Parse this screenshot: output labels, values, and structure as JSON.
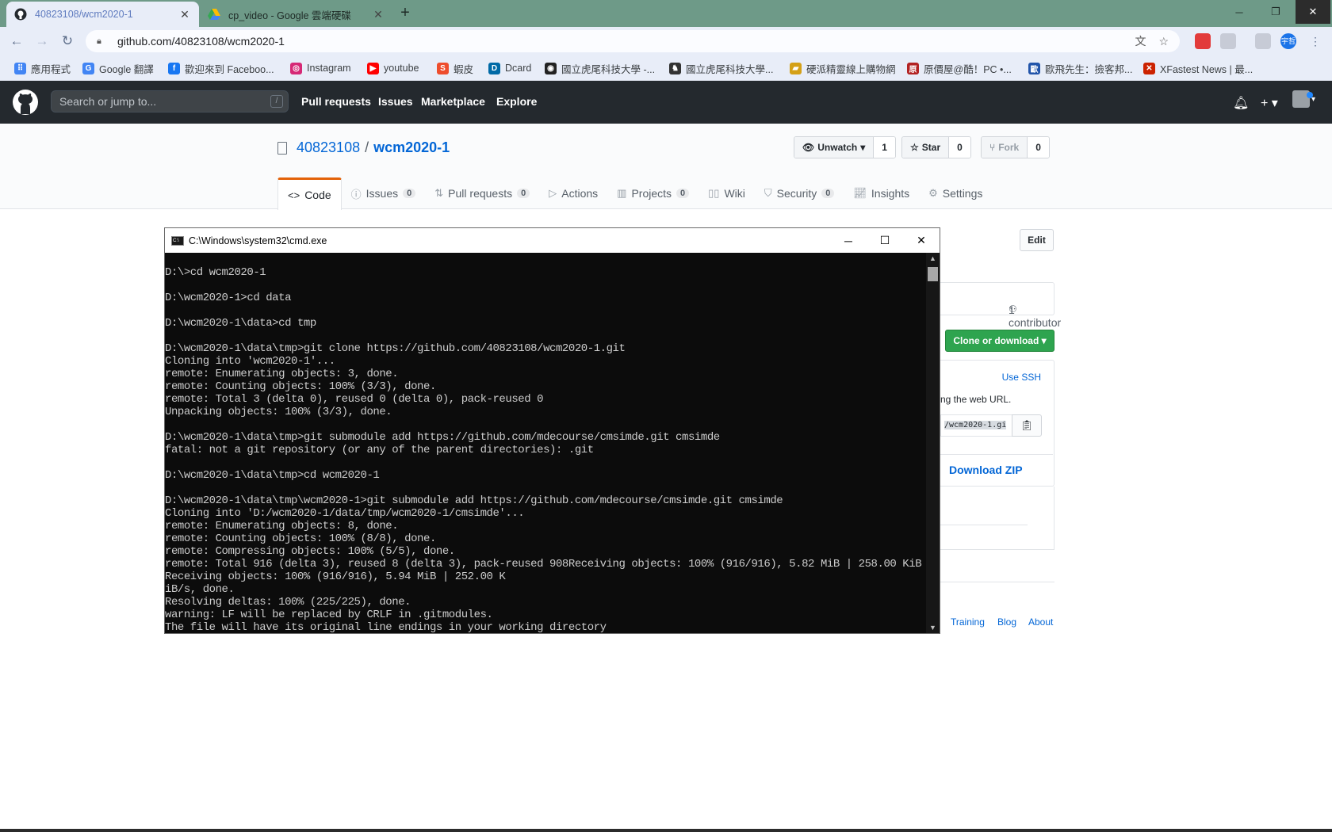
{
  "browser": {
    "tabs": [
      {
        "title": "40823108/wcm2020-1",
        "active": true
      },
      {
        "title": "cp_video - Google 雲端硬碟",
        "active": false
      }
    ],
    "url": "github.com/40823108/wcm2020-1",
    "profile_label": "宇哲",
    "bookmarks": [
      {
        "label": "應用程式",
        "color": "#4285f4"
      },
      {
        "label": "Google 翻譯",
        "color": "#4285f4"
      },
      {
        "label": "歡迎來到 Faceboo...",
        "color": "#1877f2"
      },
      {
        "label": "Instagram",
        "color": "#d62976"
      },
      {
        "label": "youtube",
        "color": "#ff0000"
      },
      {
        "label": "蝦皮",
        "color": "#ee4d2d"
      },
      {
        "label": "Dcard",
        "color": "#006aa6"
      },
      {
        "label": "國立虎尾科技大學 -...",
        "color": "#222222"
      },
      {
        "label": "國立虎尾科技大學...",
        "color": "#333333"
      },
      {
        "label": "硬派精靈線上購物網",
        "color": "#d4a017"
      },
      {
        "label": "原價屋@酷！PC •...",
        "color": "#b22222"
      },
      {
        "label": "歐飛先生：撿客邦...",
        "color": "#2255aa"
      },
      {
        "label": "XFastest News | 最...",
        "color": "#cc2200"
      }
    ]
  },
  "github": {
    "search_placeholder": "Search or jump to...",
    "search_key": "/",
    "nav": [
      "Pull requests",
      "Issues",
      "Marketplace",
      "Explore"
    ],
    "repo": {
      "owner": "40823108",
      "separator": "/",
      "name": "wcm2020-1"
    },
    "actions": [
      {
        "label": "Unwatch",
        "count": "1"
      },
      {
        "label": "Star",
        "count": "0"
      },
      {
        "label": "Fork",
        "count": "0"
      }
    ],
    "tabs": [
      {
        "label": "Code",
        "icon": "code-icon",
        "count": ""
      },
      {
        "label": "Issues",
        "icon": "issue-icon",
        "count": "0"
      },
      {
        "label": "Pull requests",
        "icon": "pull-request-icon",
        "count": "0"
      },
      {
        "label": "Actions",
        "icon": "play-icon",
        "count": ""
      },
      {
        "label": "Projects",
        "icon": "project-icon",
        "count": "0"
      },
      {
        "label": "Wiki",
        "icon": "book-icon",
        "count": ""
      },
      {
        "label": "Security",
        "icon": "shield-icon",
        "count": "0"
      },
      {
        "label": "Insights",
        "icon": "graph-icon",
        "count": ""
      },
      {
        "label": "Settings",
        "icon": "gear-icon",
        "count": ""
      }
    ],
    "edit_label": "Edit",
    "contributors": "1 contributor",
    "clone_label": "Clone or download ▾",
    "use_ssh": "Use SSH",
    "clone_hint": "ng the web URL.",
    "clone_url_fragment": "/wcm2020-1.gi",
    "download_zip": "Download ZIP",
    "footer_links": [
      "Training",
      "Blog",
      "About"
    ],
    "accent": "#0366d6",
    "green": "#2ea44f"
  },
  "cmd": {
    "title": "C:\\Windows\\system32\\cmd.exe",
    "output": "D:\\>cd wcm2020-1\n\nD:\\wcm2020-1>cd data\n\nD:\\wcm2020-1\\data>cd tmp\n\nD:\\wcm2020-1\\data\\tmp>git clone https://github.com/40823108/wcm2020-1.git\nCloning into 'wcm2020-1'...\nremote: Enumerating objects: 3, done.\nremote: Counting objects: 100% (3/3), done.\nremote: Total 3 (delta 0), reused 0 (delta 0), pack-reused 0\nUnpacking objects: 100% (3/3), done.\n\nD:\\wcm2020-1\\data\\tmp>git submodule add https://github.com/mdecourse/cmsimde.git cmsimde\nfatal: not a git repository (or any of the parent directories): .git\n\nD:\\wcm2020-1\\data\\tmp>cd wcm2020-1\n\nD:\\wcm2020-1\\data\\tmp\\wcm2020-1>git submodule add https://github.com/mdecourse/cmsimde.git cmsimde\nCloning into 'D:/wcm2020-1/data/tmp/wcm2020-1/cmsimde'...\nremote: Enumerating objects: 8, done.\nremote: Counting objects: 100% (8/8), done.\nremote: Compressing objects: 100% (5/5), done.\nremote: Total 916 (delta 3), reused 8 (delta 3), pack-reused 908Receiving objects: 100% (916/916), 5.82 MiB | 258.00 KiB\nReceiving objects: 100% (916/916), 5.94 MiB | 252.00 K\niB/s, done.\nResolving deltas: 100% (225/225), done.\nwarning: LF will be replaced by CRLF in .gitmodules.\nThe file will have its original line endings in your working directory"
  }
}
